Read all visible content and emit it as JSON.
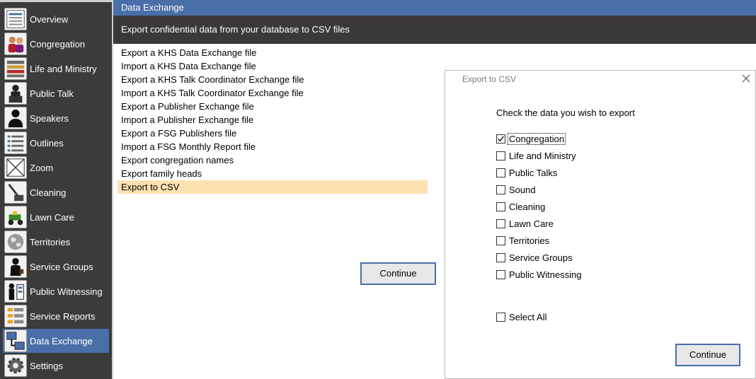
{
  "sidebar": {
    "items": [
      {
        "label": "Overview",
        "icon": "overview-icon"
      },
      {
        "label": "Congregation",
        "icon": "congregation-icon"
      },
      {
        "label": "Life and Ministry",
        "icon": "life-ministry-icon"
      },
      {
        "label": "Public Talk",
        "icon": "public-talk-icon"
      },
      {
        "label": "Speakers",
        "icon": "speakers-icon"
      },
      {
        "label": "Outlines",
        "icon": "outlines-icon"
      },
      {
        "label": "Zoom",
        "icon": "zoom-icon"
      },
      {
        "label": "Cleaning",
        "icon": "cleaning-icon"
      },
      {
        "label": "Lawn Care",
        "icon": "lawn-care-icon"
      },
      {
        "label": "Territories",
        "icon": "territories-icon"
      },
      {
        "label": "Service Groups",
        "icon": "service-groups-icon"
      },
      {
        "label": "Public Witnessing",
        "icon": "public-witnessing-icon"
      },
      {
        "label": "Service Reports",
        "icon": "service-reports-icon"
      },
      {
        "label": "Data Exchange",
        "icon": "data-exchange-icon"
      },
      {
        "label": "Settings",
        "icon": "settings-icon"
      }
    ],
    "active_index": 13
  },
  "main": {
    "title": "Data Exchange",
    "subtitle": "Export confidential data from your database to CSV files",
    "tasks": [
      "Export a KHS Data Exchange file",
      "Import a KHS Data Exchange file",
      "Export a KHS Talk Coordinator Exchange file",
      "Import a KHS Talk Coordinator Exchange file",
      "Export a Publisher Exchange file",
      "Import a Publisher Exchange file",
      "Export a FSG Publishers file",
      "Import a FSG Monthly Report file",
      "Export congregation names",
      "Export family heads",
      "Export to CSV"
    ],
    "selected_task_index": 10,
    "continue_label": "Continue"
  },
  "dialog": {
    "title": "Export to CSV",
    "prompt": "Check the data you wish to export",
    "options": [
      {
        "label": "Congregation",
        "checked": true
      },
      {
        "label": "Life and Ministry",
        "checked": false
      },
      {
        "label": "Public Talks",
        "checked": false
      },
      {
        "label": "Sound",
        "checked": false
      },
      {
        "label": "Cleaning",
        "checked": false
      },
      {
        "label": "Lawn Care",
        "checked": false
      },
      {
        "label": "Territories",
        "checked": false
      },
      {
        "label": "Service Groups",
        "checked": false
      },
      {
        "label": "Public Witnessing",
        "checked": false
      }
    ],
    "select_all": {
      "label": "Select All",
      "checked": false
    },
    "continue_label": "Continue"
  },
  "colors": {
    "accent": "#4a6fa8",
    "sidebar_bg": "#3b3b3b",
    "subheader_bg": "#3b3838",
    "selected_row": "#fde2b1"
  }
}
